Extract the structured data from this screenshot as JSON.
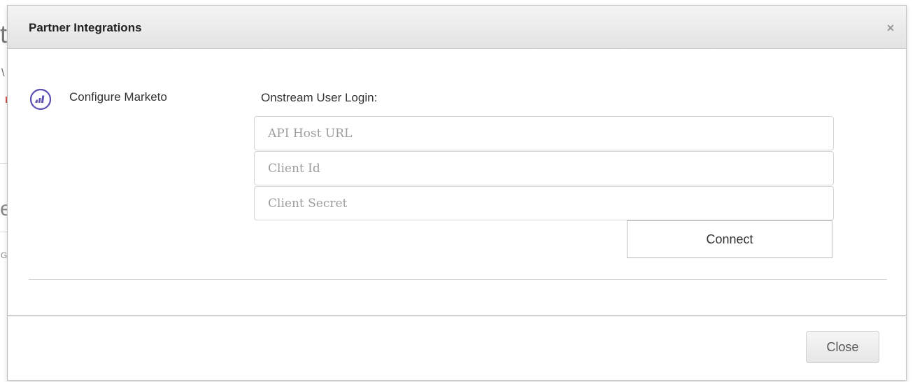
{
  "background": {
    "fragments": [
      "t",
      "\\",
      "e",
      "G"
    ]
  },
  "modal": {
    "title": "Partner Integrations",
    "close_icon": "close-icon",
    "integration": {
      "icon": "marketo-icon",
      "label": "Configure Marketo"
    },
    "login": {
      "label": "Onstream User Login:",
      "api_host_url": {
        "value": "",
        "placeholder": "API Host URL"
      },
      "client_id": {
        "value": "",
        "placeholder": "Client Id"
      },
      "client_secret": {
        "value": "",
        "placeholder": "Client Secret"
      },
      "connect_label": "Connect"
    },
    "footer": {
      "close_label": "Close"
    }
  },
  "colors": {
    "marketo_purple": "#5a4fb3",
    "header_gradient_top": "#f4f4f4",
    "header_gradient_bottom": "#e3e3e3"
  }
}
